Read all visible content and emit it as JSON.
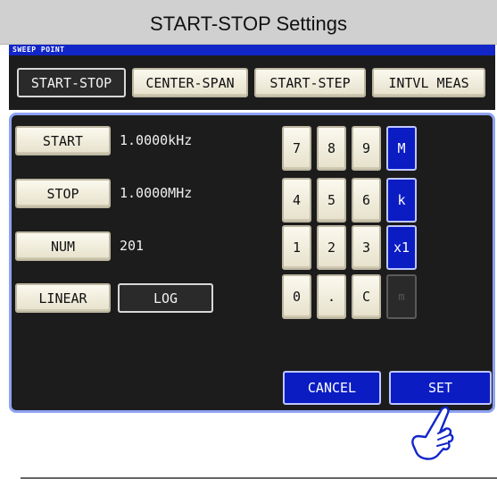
{
  "title": "START-STOP Settings",
  "section_label": "SWEEP POINT",
  "tabs": [
    {
      "label": "START-STOP",
      "selected": true
    },
    {
      "label": "CENTER-SPAN",
      "selected": false
    },
    {
      "label": "START-STEP",
      "selected": false
    },
    {
      "label": "INTVL MEAS",
      "selected": false
    }
  ],
  "params": {
    "start": {
      "label": "START",
      "value": "1.0000kHz"
    },
    "stop": {
      "label": "STOP",
      "value": "1.0000MHz"
    },
    "num": {
      "label": "NUM",
      "value": "201"
    }
  },
  "scale": {
    "linear": "LINEAR",
    "log": "LOG",
    "selected": "LOG"
  },
  "keypad": {
    "keys": [
      "7",
      "8",
      "9",
      "4",
      "5",
      "6",
      "1",
      "2",
      "3",
      "0",
      ".",
      "C"
    ],
    "units": [
      "M",
      "k",
      "x1",
      "m"
    ]
  },
  "actions": {
    "cancel": "CANCEL",
    "set": "SET"
  },
  "icons": {
    "hand": "pointing-hand-icon"
  },
  "colors": {
    "accent": "#0b1cc3",
    "panel": "#1c1c1c",
    "button": "#f2efdf",
    "border": "#8ea2f2"
  }
}
